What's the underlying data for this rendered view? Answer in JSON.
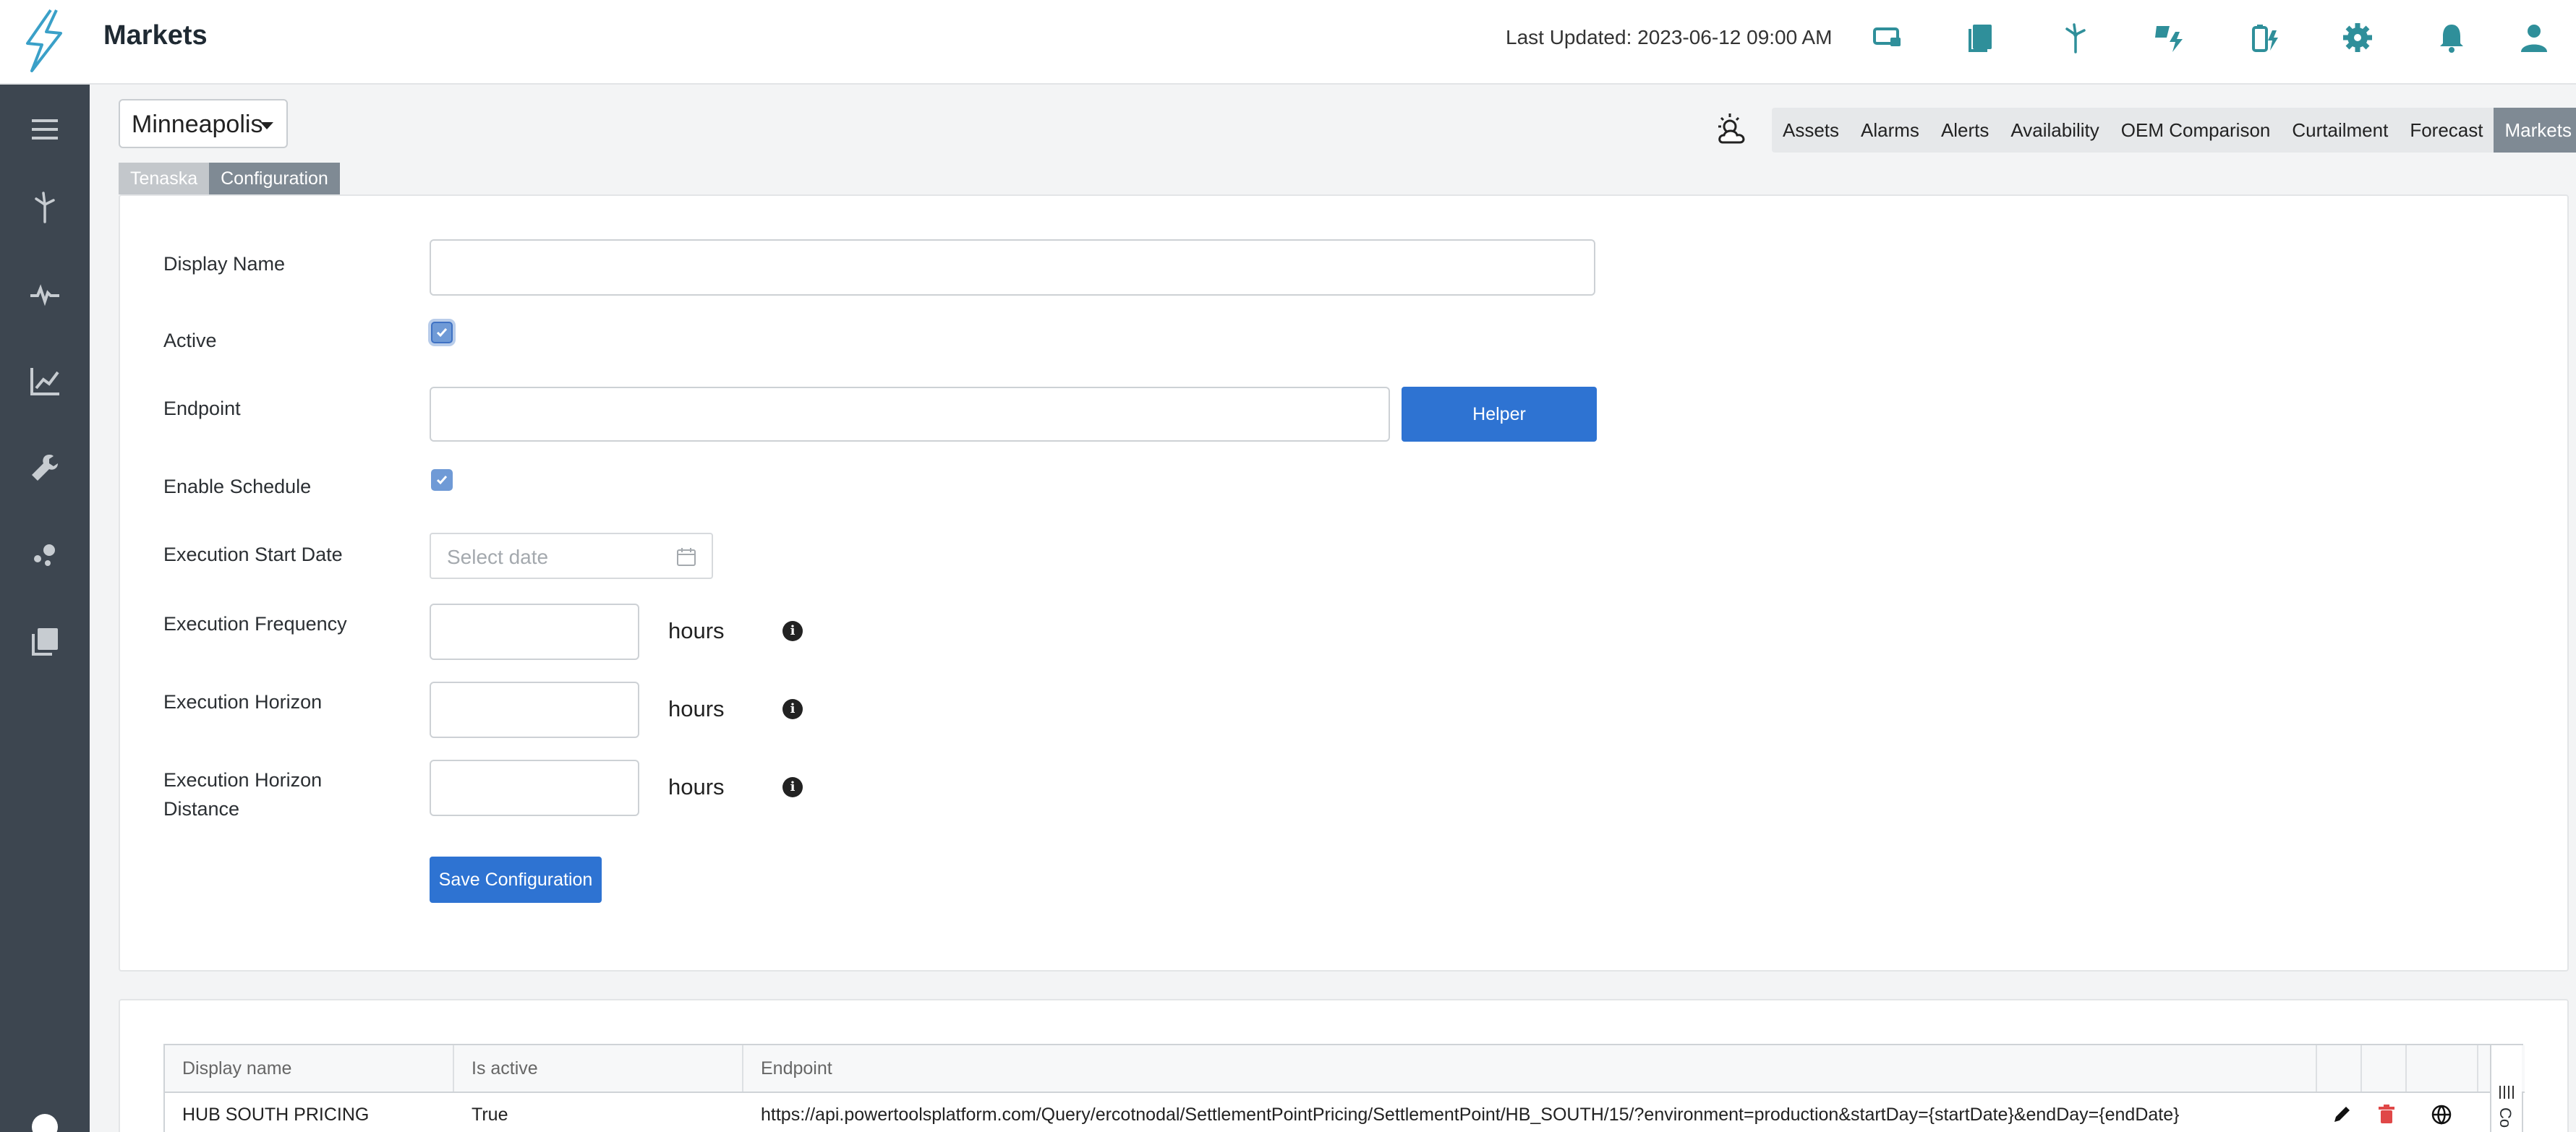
{
  "header": {
    "title": "Markets",
    "last_updated": "Last Updated: 2023-06-12 09:00 AM",
    "icons": [
      "monitor-icon",
      "documents-icon",
      "wind-turbine-icon",
      "solar-power-icon",
      "battery-icon",
      "gear-icon",
      "bell-icon",
      "user-icon"
    ]
  },
  "sidebar": {
    "items": [
      "menu-icon",
      "wind-turbine-icon",
      "pulse-icon",
      "line-chart-icon",
      "wrench-icon",
      "scatter-icon",
      "library-icon"
    ]
  },
  "site_select": {
    "value": "Minneapolis"
  },
  "nav_tabs": [
    "Assets",
    "Alarms",
    "Alerts",
    "Availability",
    "OEM Comparison",
    "Curtailment",
    "Forecast",
    "Markets"
  ],
  "sub_tabs": [
    "Tenaska",
    "Configuration"
  ],
  "form": {
    "display_name_label": "Display Name",
    "display_name_value": "",
    "active_label": "Active",
    "active_checked": true,
    "endpoint_label": "Endpoint",
    "endpoint_value": "",
    "helper_button": "Helper",
    "enable_schedule_label": "Enable Schedule",
    "enable_schedule_checked": true,
    "start_date_label": "Execution Start Date",
    "start_date_placeholder": "Select date",
    "frequency_label": "Execution Frequency",
    "horizon_label": "Execution Horizon",
    "horizon_distance_label": "Execution Horizon Distance",
    "unit": "hours",
    "save_button": "Save Configuration"
  },
  "table": {
    "columns": [
      "Display name",
      "Is active",
      "Endpoint"
    ],
    "rows": [
      {
        "display_name": "HUB SOUTH PRICING",
        "is_active": "True",
        "endpoint": "https://api.powertoolsplatform.com/Query/ercotnodal/SettlementPointPricing/SettlementPoint/HB_SOUTH/15/?environment=production&startDay={startDate}&endDay={endDate}"
      }
    ],
    "side_tab_label": "Co"
  },
  "colors": {
    "sidebar": "#3d4650",
    "primary": "#2e73d2",
    "accent": "#2f8f9a",
    "tab_active": "#7f8a94"
  }
}
